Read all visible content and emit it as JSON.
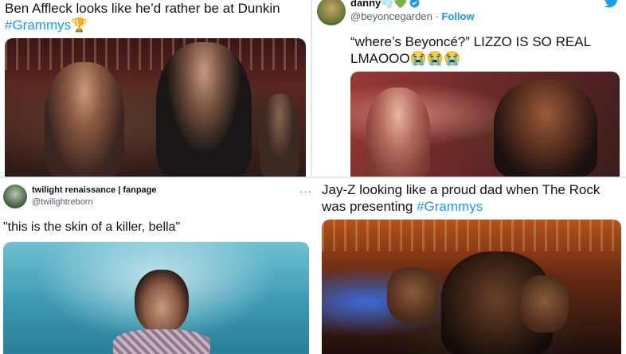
{
  "colors": {
    "text": "#0f1419",
    "secondary": "#536471",
    "link": "#1d9bf0"
  },
  "tweet1": {
    "text": "Ben Affleck looks like he’d rather be at Dunkin",
    "hashtag": "#Grammys",
    "emoji": "🏆",
    "media_alt": "Ben Affleck and Jennifer Lopez at the Grammys"
  },
  "tweet2": {
    "name": "danny",
    "name_emoji": "🫧💚",
    "verified_icon": "verified-badge-icon",
    "handle": "@beyoncegarden",
    "separator": "·",
    "follow_label": "Follow",
    "brand_icon": "twitter-bird-icon",
    "text": "“where’s Beyoncé?” LIZZO IS SO REAL LMAOOO😭😭😭",
    "media_alt": "Lizzo looking around at the Grammys"
  },
  "tweet3": {
    "name": "twilight renaissance | fanpage",
    "handle": "@twilightreborn",
    "more": "···",
    "text": "\"this is the skin of a killer, bella\"",
    "media_alt": "Harry Styles on stage"
  },
  "tweet4": {
    "text": "Jay-Z looking like a proud dad when The Rock was presenting",
    "hashtag": "#Grammys",
    "media_alt": "Jay-Z cheering in the audience"
  }
}
